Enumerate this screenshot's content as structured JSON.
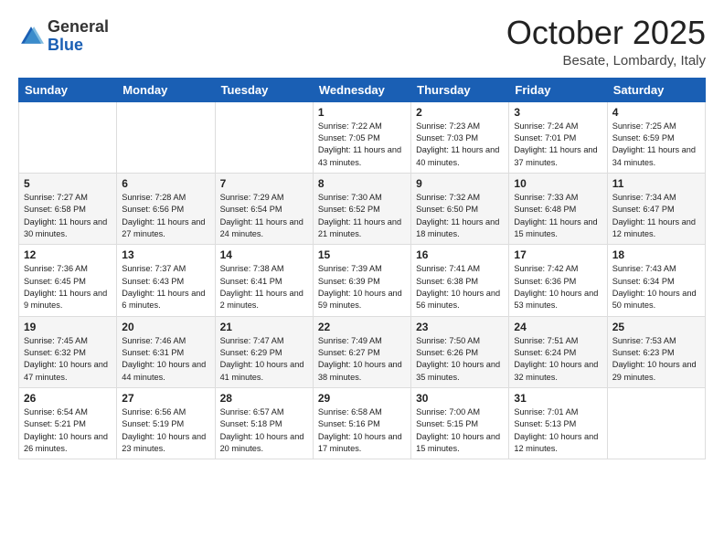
{
  "logo": {
    "general": "General",
    "blue": "Blue"
  },
  "title": "October 2025",
  "location": "Besate, Lombardy, Italy",
  "days_header": [
    "Sunday",
    "Monday",
    "Tuesday",
    "Wednesday",
    "Thursday",
    "Friday",
    "Saturday"
  ],
  "weeks": [
    [
      {
        "day": "",
        "sunrise": "",
        "sunset": "",
        "daylight": ""
      },
      {
        "day": "",
        "sunrise": "",
        "sunset": "",
        "daylight": ""
      },
      {
        "day": "",
        "sunrise": "",
        "sunset": "",
        "daylight": ""
      },
      {
        "day": "1",
        "sunrise": "Sunrise: 7:22 AM",
        "sunset": "Sunset: 7:05 PM",
        "daylight": "Daylight: 11 hours and 43 minutes."
      },
      {
        "day": "2",
        "sunrise": "Sunrise: 7:23 AM",
        "sunset": "Sunset: 7:03 PM",
        "daylight": "Daylight: 11 hours and 40 minutes."
      },
      {
        "day": "3",
        "sunrise": "Sunrise: 7:24 AM",
        "sunset": "Sunset: 7:01 PM",
        "daylight": "Daylight: 11 hours and 37 minutes."
      },
      {
        "day": "4",
        "sunrise": "Sunrise: 7:25 AM",
        "sunset": "Sunset: 6:59 PM",
        "daylight": "Daylight: 11 hours and 34 minutes."
      }
    ],
    [
      {
        "day": "5",
        "sunrise": "Sunrise: 7:27 AM",
        "sunset": "Sunset: 6:58 PM",
        "daylight": "Daylight: 11 hours and 30 minutes."
      },
      {
        "day": "6",
        "sunrise": "Sunrise: 7:28 AM",
        "sunset": "Sunset: 6:56 PM",
        "daylight": "Daylight: 11 hours and 27 minutes."
      },
      {
        "day": "7",
        "sunrise": "Sunrise: 7:29 AM",
        "sunset": "Sunset: 6:54 PM",
        "daylight": "Daylight: 11 hours and 24 minutes."
      },
      {
        "day": "8",
        "sunrise": "Sunrise: 7:30 AM",
        "sunset": "Sunset: 6:52 PM",
        "daylight": "Daylight: 11 hours and 21 minutes."
      },
      {
        "day": "9",
        "sunrise": "Sunrise: 7:32 AM",
        "sunset": "Sunset: 6:50 PM",
        "daylight": "Daylight: 11 hours and 18 minutes."
      },
      {
        "day": "10",
        "sunrise": "Sunrise: 7:33 AM",
        "sunset": "Sunset: 6:48 PM",
        "daylight": "Daylight: 11 hours and 15 minutes."
      },
      {
        "day": "11",
        "sunrise": "Sunrise: 7:34 AM",
        "sunset": "Sunset: 6:47 PM",
        "daylight": "Daylight: 11 hours and 12 minutes."
      }
    ],
    [
      {
        "day": "12",
        "sunrise": "Sunrise: 7:36 AM",
        "sunset": "Sunset: 6:45 PM",
        "daylight": "Daylight: 11 hours and 9 minutes."
      },
      {
        "day": "13",
        "sunrise": "Sunrise: 7:37 AM",
        "sunset": "Sunset: 6:43 PM",
        "daylight": "Daylight: 11 hours and 6 minutes."
      },
      {
        "day": "14",
        "sunrise": "Sunrise: 7:38 AM",
        "sunset": "Sunset: 6:41 PM",
        "daylight": "Daylight: 11 hours and 2 minutes."
      },
      {
        "day": "15",
        "sunrise": "Sunrise: 7:39 AM",
        "sunset": "Sunset: 6:39 PM",
        "daylight": "Daylight: 10 hours and 59 minutes."
      },
      {
        "day": "16",
        "sunrise": "Sunrise: 7:41 AM",
        "sunset": "Sunset: 6:38 PM",
        "daylight": "Daylight: 10 hours and 56 minutes."
      },
      {
        "day": "17",
        "sunrise": "Sunrise: 7:42 AM",
        "sunset": "Sunset: 6:36 PM",
        "daylight": "Daylight: 10 hours and 53 minutes."
      },
      {
        "day": "18",
        "sunrise": "Sunrise: 7:43 AM",
        "sunset": "Sunset: 6:34 PM",
        "daylight": "Daylight: 10 hours and 50 minutes."
      }
    ],
    [
      {
        "day": "19",
        "sunrise": "Sunrise: 7:45 AM",
        "sunset": "Sunset: 6:32 PM",
        "daylight": "Daylight: 10 hours and 47 minutes."
      },
      {
        "day": "20",
        "sunrise": "Sunrise: 7:46 AM",
        "sunset": "Sunset: 6:31 PM",
        "daylight": "Daylight: 10 hours and 44 minutes."
      },
      {
        "day": "21",
        "sunrise": "Sunrise: 7:47 AM",
        "sunset": "Sunset: 6:29 PM",
        "daylight": "Daylight: 10 hours and 41 minutes."
      },
      {
        "day": "22",
        "sunrise": "Sunrise: 7:49 AM",
        "sunset": "Sunset: 6:27 PM",
        "daylight": "Daylight: 10 hours and 38 minutes."
      },
      {
        "day": "23",
        "sunrise": "Sunrise: 7:50 AM",
        "sunset": "Sunset: 6:26 PM",
        "daylight": "Daylight: 10 hours and 35 minutes."
      },
      {
        "day": "24",
        "sunrise": "Sunrise: 7:51 AM",
        "sunset": "Sunset: 6:24 PM",
        "daylight": "Daylight: 10 hours and 32 minutes."
      },
      {
        "day": "25",
        "sunrise": "Sunrise: 7:53 AM",
        "sunset": "Sunset: 6:23 PM",
        "daylight": "Daylight: 10 hours and 29 minutes."
      }
    ],
    [
      {
        "day": "26",
        "sunrise": "Sunrise: 6:54 AM",
        "sunset": "Sunset: 5:21 PM",
        "daylight": "Daylight: 10 hours and 26 minutes."
      },
      {
        "day": "27",
        "sunrise": "Sunrise: 6:56 AM",
        "sunset": "Sunset: 5:19 PM",
        "daylight": "Daylight: 10 hours and 23 minutes."
      },
      {
        "day": "28",
        "sunrise": "Sunrise: 6:57 AM",
        "sunset": "Sunset: 5:18 PM",
        "daylight": "Daylight: 10 hours and 20 minutes."
      },
      {
        "day": "29",
        "sunrise": "Sunrise: 6:58 AM",
        "sunset": "Sunset: 5:16 PM",
        "daylight": "Daylight: 10 hours and 17 minutes."
      },
      {
        "day": "30",
        "sunrise": "Sunrise: 7:00 AM",
        "sunset": "Sunset: 5:15 PM",
        "daylight": "Daylight: 10 hours and 15 minutes."
      },
      {
        "day": "31",
        "sunrise": "Sunrise: 7:01 AM",
        "sunset": "Sunset: 5:13 PM",
        "daylight": "Daylight: 10 hours and 12 minutes."
      },
      {
        "day": "",
        "sunrise": "",
        "sunset": "",
        "daylight": ""
      }
    ]
  ]
}
